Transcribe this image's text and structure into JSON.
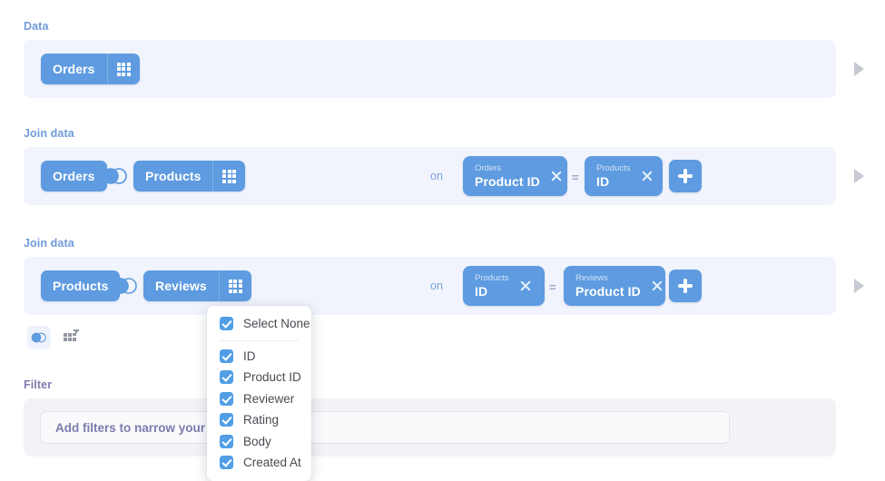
{
  "sections": {
    "data": {
      "label": "Data",
      "table": "Orders",
      "table_icon": "grid-icon"
    },
    "join1": {
      "label": "Join data",
      "left_table": "Orders",
      "right_table": "Products",
      "join_icon": "venn-left-join-icon",
      "table_icon": "grid-icon",
      "on_label": "on",
      "left_condition": {
        "table": "Orders",
        "field": "Product ID"
      },
      "operator": "=",
      "right_condition": {
        "table": "Products",
        "field": "ID"
      },
      "add_label": "+"
    },
    "join2": {
      "label": "Join data",
      "left_table": "Products",
      "right_table": "Reviews",
      "join_icon": "venn-left-join-icon",
      "table_icon": "grid-icon",
      "on_label": "on",
      "left_condition": {
        "table": "Products",
        "field": "ID"
      },
      "operator": "=",
      "right_condition": {
        "table": "Reviews",
        "field": "Product ID"
      },
      "add_label": "+"
    },
    "filter": {
      "label": "Filter",
      "placeholder": "Add filters to narrow your answer"
    }
  },
  "tools": {
    "join_columns_icon": "venn-columns-icon",
    "add_table_icon": "grid-plus-icon"
  },
  "preview_arrows": [
    {
      "name": "preview-data-row",
      "icon": "play-icon"
    },
    {
      "name": "preview-join1-row",
      "icon": "play-icon"
    },
    {
      "name": "preview-join2-row",
      "icon": "play-icon"
    }
  ],
  "column_picker": {
    "select_none_label": "Select None",
    "select_none_checked": true,
    "columns": [
      {
        "label": "ID",
        "checked": true
      },
      {
        "label": "Product ID",
        "checked": true
      },
      {
        "label": "Reviewer",
        "checked": true
      },
      {
        "label": "Rating",
        "checked": true
      },
      {
        "label": "Body",
        "checked": true
      },
      {
        "label": "Created At",
        "checked": true
      }
    ]
  },
  "colors": {
    "pill_blue": "#5E9BE0",
    "row_bg": "#F1F4FC",
    "section_label_blue": "#6F9BDB",
    "section_label_purple": "#7C7BAE",
    "checkbox_blue": "#519EE6"
  }
}
